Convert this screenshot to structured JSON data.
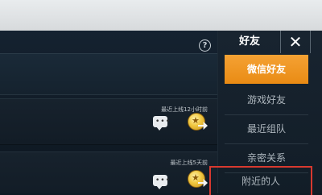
{
  "sidebar": {
    "title": "好友",
    "close": "✕",
    "items": [
      {
        "label": "微信好友"
      },
      {
        "label": "游戏好友"
      },
      {
        "label": "最近组队"
      },
      {
        "label": "亲密关系"
      },
      {
        "label": "附近的人"
      }
    ]
  },
  "header": {
    "help": "?"
  },
  "friends": [
    {
      "last_online": "最近上线12小时前"
    },
    {
      "last_online": "最近上线5天前"
    }
  ],
  "icons": {
    "chat": "chat-bubble-icon",
    "gift": "gold-coin-send-icon",
    "help": "help-icon",
    "close": "close-icon"
  },
  "colors": {
    "active_tab": "#ef951e",
    "highlight_border": "#d8392f"
  }
}
